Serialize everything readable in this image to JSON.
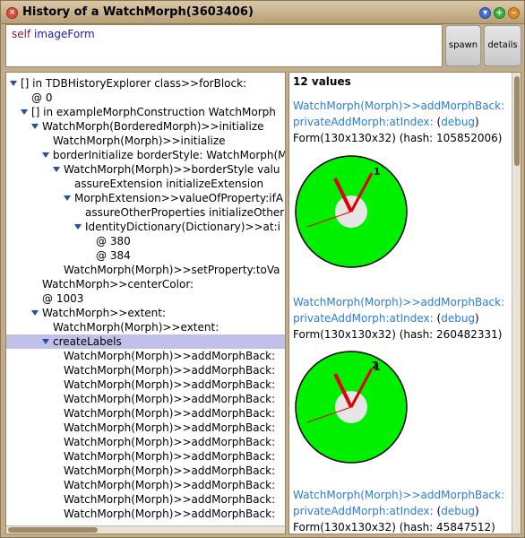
{
  "window": {
    "title": "History of a WatchMorph(3603406)",
    "close_glyph": "×",
    "menu_glyph": "▾",
    "expand_glyph": "+",
    "collapse_glyph": "–"
  },
  "code": {
    "receiver": "self",
    "message": "imageForm"
  },
  "buttons": {
    "spawn": "spawn",
    "details": "details"
  },
  "tree": [
    {
      "label": "[] in TDBHistoryExplorer class>>forBlock:",
      "indent": 0,
      "expanded": true
    },
    {
      "label": "@ 0",
      "indent": 1,
      "expanded": false
    },
    {
      "label": "[] in exampleMorphConstruction WatchMorph",
      "indent": 1,
      "expanded": true
    },
    {
      "label": "WatchMorph(BorderedMorph)>>initialize",
      "indent": 2,
      "expanded": true
    },
    {
      "label": "WatchMorph(Morph)>>initialize",
      "indent": 3,
      "expanded": false
    },
    {
      "label": "borderInitialize borderStyle: WatchMorph(M",
      "indent": 3,
      "expanded": true
    },
    {
      "label": "WatchMorph(Morph)>>borderStyle valu",
      "indent": 4,
      "expanded": true
    },
    {
      "label": "assureExtension initializeExtension",
      "indent": 5,
      "expanded": false
    },
    {
      "label": "MorphExtension>>valueOfProperty:ifA",
      "indent": 5,
      "expanded": true
    },
    {
      "label": "assureOtherProperties initializeOther",
      "indent": 6,
      "expanded": false
    },
    {
      "label": "IdentityDictionary(Dictionary)>>at:i",
      "indent": 6,
      "expanded": true
    },
    {
      "label": "@ 380",
      "indent": 7,
      "expanded": false
    },
    {
      "label": "@ 384",
      "indent": 7,
      "expanded": false
    },
    {
      "label": "WatchMorph(Morph)>>setProperty:toVa",
      "indent": 4,
      "expanded": false
    },
    {
      "label": "WatchMorph>>centerColor:",
      "indent": 2,
      "expanded": false
    },
    {
      "label": "@ 1003",
      "indent": 2,
      "expanded": false
    },
    {
      "label": "WatchMorph>>extent:",
      "indent": 2,
      "expanded": true
    },
    {
      "label": "WatchMorph(Morph)>>extent:",
      "indent": 3,
      "expanded": false
    },
    {
      "label": "createLabels",
      "indent": 3,
      "expanded": true,
      "selected": true
    },
    {
      "label": "WatchMorph(Morph)>>addMorphBack:",
      "indent": 4,
      "expanded": false
    },
    {
      "label": "WatchMorph(Morph)>>addMorphBack:",
      "indent": 4,
      "expanded": false
    },
    {
      "label": "WatchMorph(Morph)>>addMorphBack:",
      "indent": 4,
      "expanded": false
    },
    {
      "label": "WatchMorph(Morph)>>addMorphBack:",
      "indent": 4,
      "expanded": false
    },
    {
      "label": "WatchMorph(Morph)>>addMorphBack:",
      "indent": 4,
      "expanded": false
    },
    {
      "label": "WatchMorph(Morph)>>addMorphBack:",
      "indent": 4,
      "expanded": false
    },
    {
      "label": "WatchMorph(Morph)>>addMorphBack:",
      "indent": 4,
      "expanded": false
    },
    {
      "label": "WatchMorph(Morph)>>addMorphBack:",
      "indent": 4,
      "expanded": false
    },
    {
      "label": "WatchMorph(Morph)>>addMorphBack:",
      "indent": 4,
      "expanded": false
    },
    {
      "label": "WatchMorph(Morph)>>addMorphBack:",
      "indent": 4,
      "expanded": false
    },
    {
      "label": "WatchMorph(Morph)>>addMorphBack:",
      "indent": 4,
      "expanded": false
    },
    {
      "label": "WatchMorph(Morph)>>addMorphBack:",
      "indent": 4,
      "expanded": false
    }
  ],
  "values_pane": {
    "count_label": "12 values",
    "entries": [
      {
        "line1": "WatchMorph(Morph)>>addMorphBack:",
        "line2": "privateAddMorph:atIndex: ",
        "debug": "debug",
        "form": "Form(130x130x32) (hash: 105852006)",
        "labels": [
          "1"
        ]
      },
      {
        "line1": "WatchMorph(Morph)>>addMorphBack:",
        "line2": "privateAddMorph:atIndex: ",
        "debug": "debug",
        "form": "Form(130x130x32) (hash: 260482331)",
        "labels": [
          "1",
          "2"
        ]
      },
      {
        "line1": "WatchMorph(Morph)>>addMorphBack:",
        "line2": "privateAddMorph:atIndex: ",
        "debug": "debug",
        "form": "Form(130x130x32) (hash: 45847512)",
        "labels": []
      }
    ]
  },
  "colors": {
    "clock_face": "#00f000",
    "clock_center": "#e6e6e6",
    "hands": "#e00000"
  }
}
